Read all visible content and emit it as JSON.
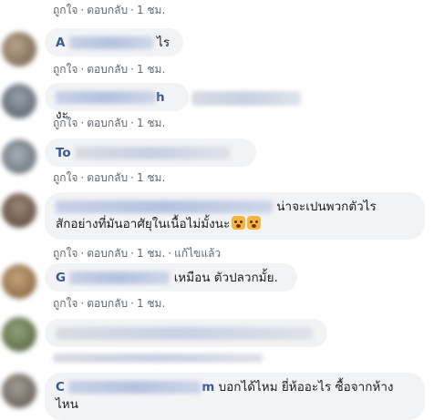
{
  "actions": {
    "like": "ถูกใจ",
    "reply": "ตอบกลับ",
    "separator": "·",
    "time": "1 ชม.",
    "edited": "แก้ไขแล้ว"
  },
  "comments": [
    {
      "author_fragment": "",
      "text": ""
    },
    {
      "author_fragment": "A",
      "text": "ไร"
    },
    {
      "author_fragment": "h",
      "text": "งะ"
    },
    {
      "author_fragment": "To",
      "text": ""
    },
    {
      "author_fragment": "",
      "text": "น่าจะเปนพวกตัวไร",
      "text_line2": "สักอย่างที่มันอาศัยุในเนื้อไม่มั้งนะ"
    },
    {
      "author_fragment": "G",
      "text": "เหมือน ตัวปลวกมั้ย."
    },
    {
      "author_fragment": "",
      "text": ""
    },
    {
      "author_fragment": "C",
      "author_end": "m",
      "text": "บอกได้ไหม ยี่ห้ออะไร ซื้อจากห้าง",
      "text_line2": "ไหน"
    }
  ],
  "colors": {
    "bubble_bg": "#f2f3f5",
    "author": "#385898",
    "meta": "#606770",
    "text": "#1c1e21"
  },
  "icons": {
    "emoji": "astonished-face-emoji"
  }
}
